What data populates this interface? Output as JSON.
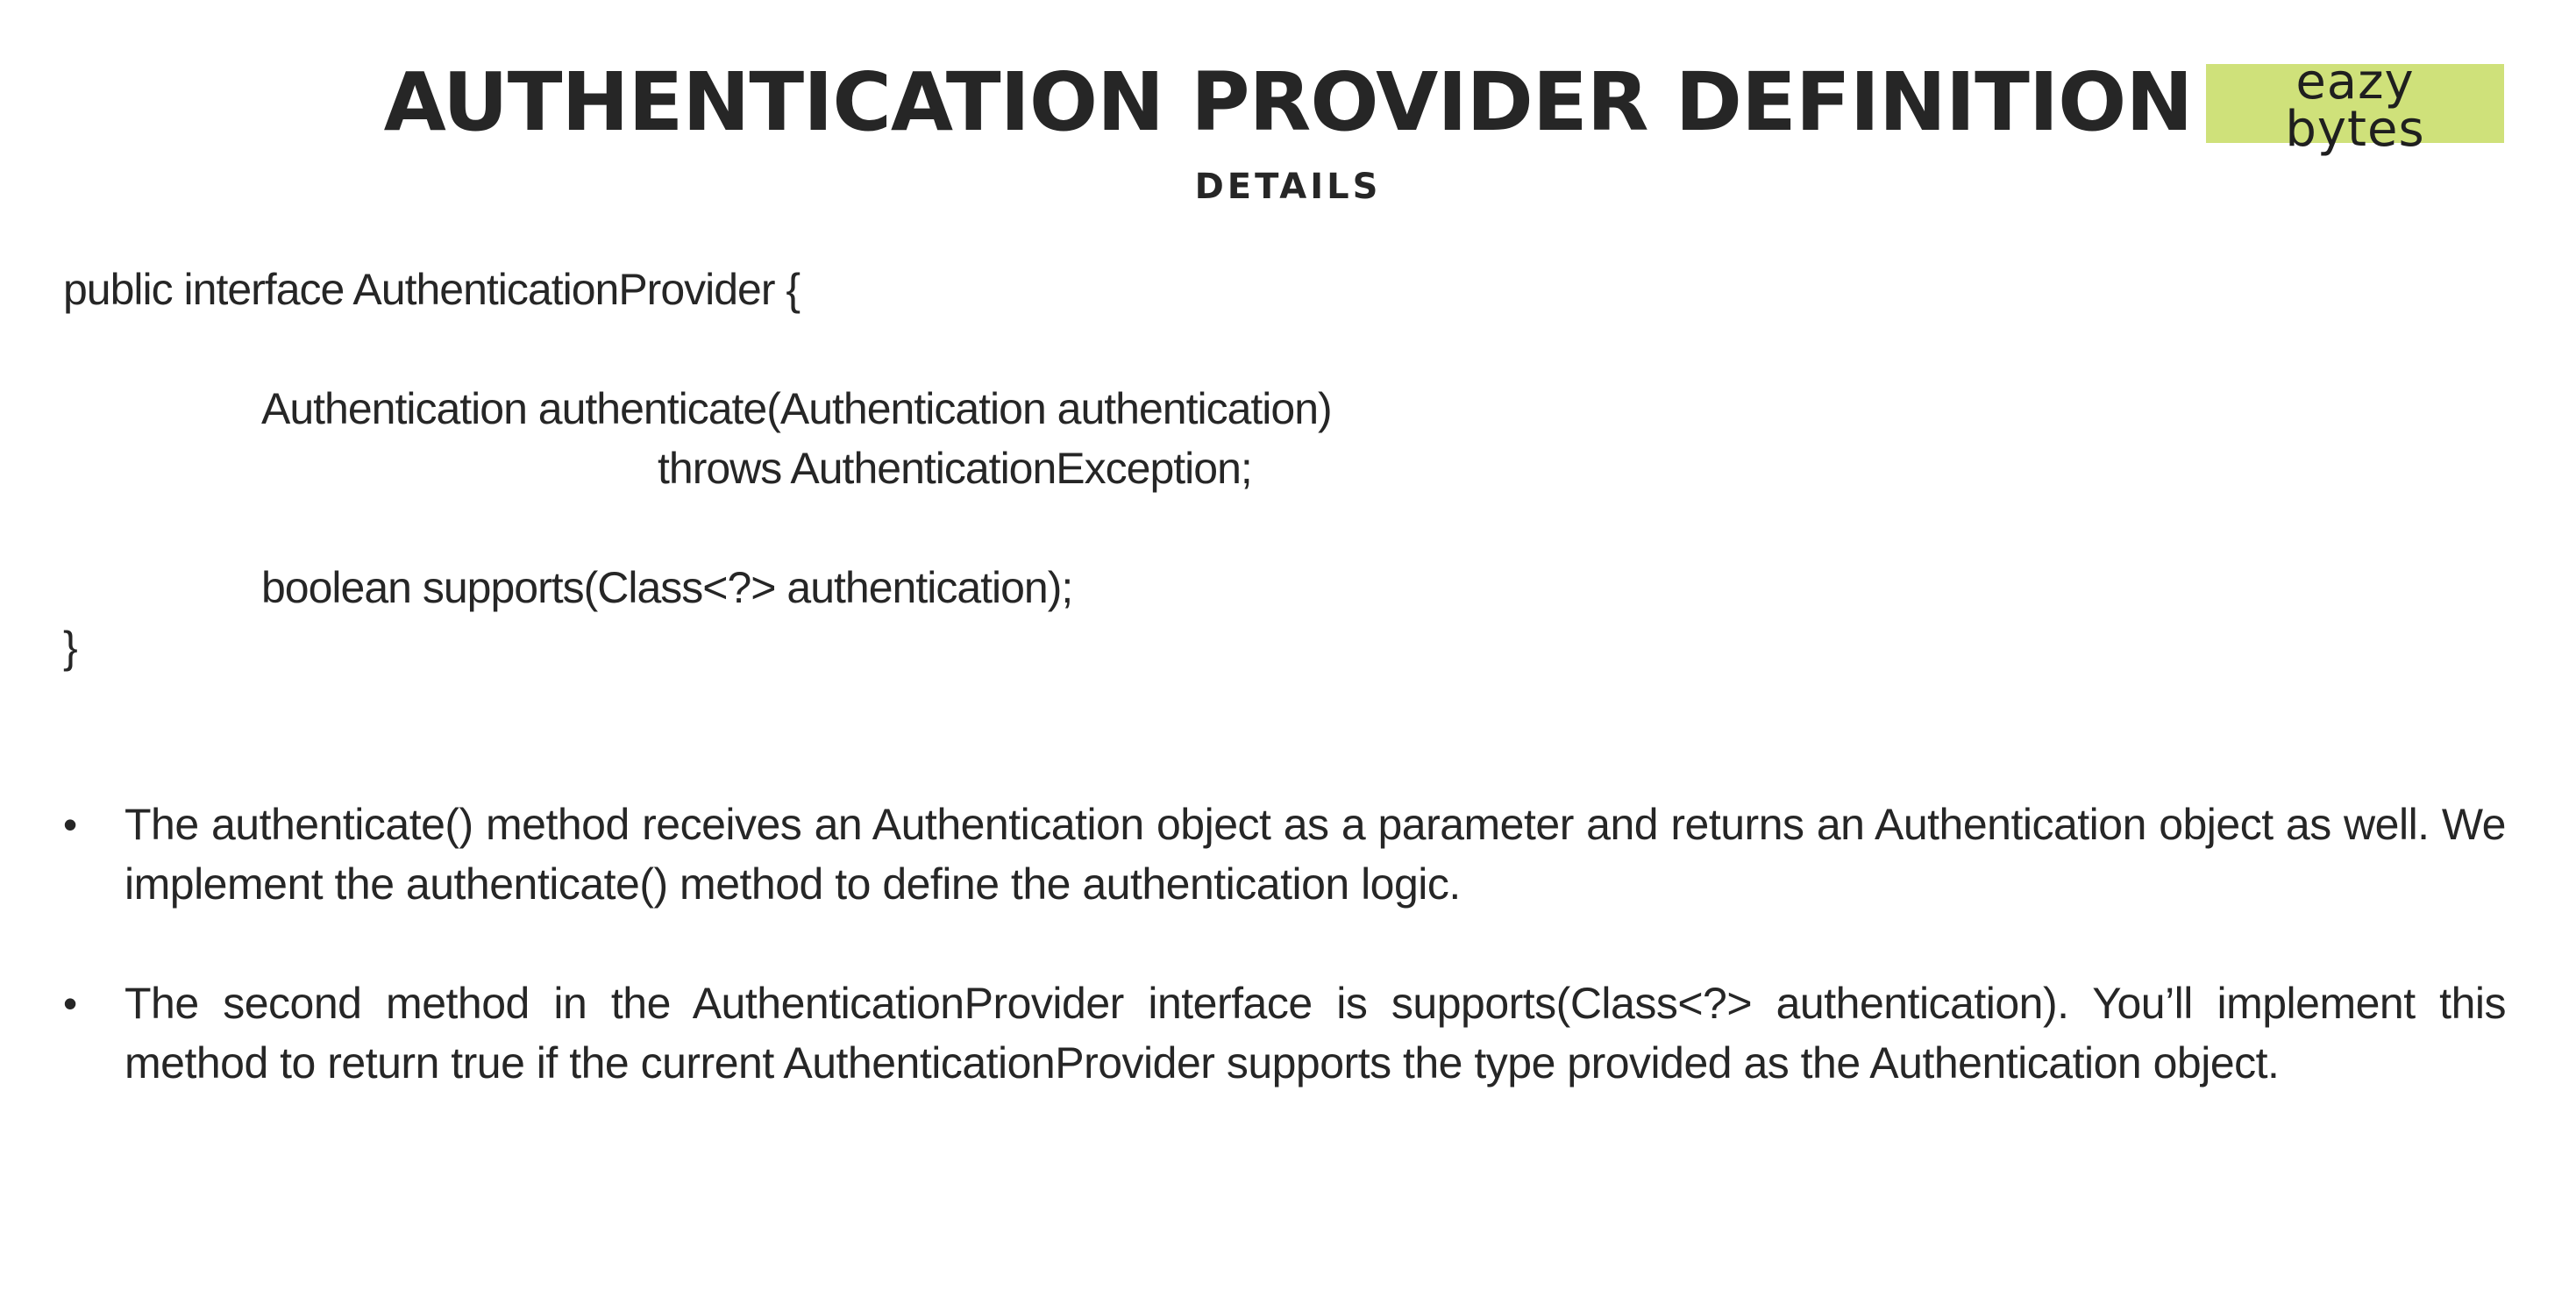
{
  "slide": {
    "title": "AUTHENTICATION PROVIDER DEFINITION",
    "subtitle": "DETAILS",
    "logo": {
      "line1": "eazy",
      "line2": "bytes",
      "background": "#cfe17a"
    }
  },
  "code": {
    "lines": [
      "public interface AuthenticationProvider {",
      "",
      "Authentication authenticate(Authentication authentication)",
      "throws AuthenticationException;",
      "",
      "boolean supports(Class<?> authentication);",
      "}"
    ]
  },
  "bullets": [
    {
      "marker": "•",
      "text": "The authenticate() method receives an Authentication object as a parameter and returns an Authentication object as well. We implement the authenticate() method to define the authentication logic."
    },
    {
      "marker": "•",
      "text": "The second method in the AuthenticationProvider interface is supports(Class<?> authentication). You’ll implement this method to return true if the current AuthenticationProvider supports the type provided as the Authentication object."
    }
  ]
}
